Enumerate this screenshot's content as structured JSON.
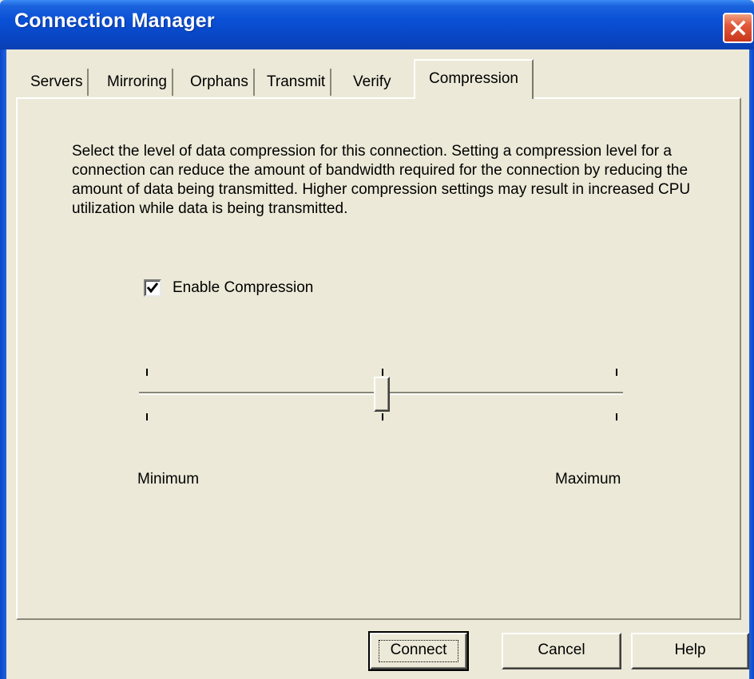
{
  "window": {
    "title": "Connection Manager"
  },
  "tabs": [
    {
      "label": "Servers"
    },
    {
      "label": "Mirroring"
    },
    {
      "label": "Orphans"
    },
    {
      "label": "Transmit"
    },
    {
      "label": "Verify"
    },
    {
      "label": "Compression",
      "active": true
    }
  ],
  "compression": {
    "description": "Select the level of data compression for this connection.  Setting a compression level for a connection can reduce the amount of bandwidth required for the connection by reducing the amount of data being transmitted. Higher compression settings may result in increased CPU utilization while data is being transmitted.",
    "enable_checkbox": {
      "label": "Enable Compression",
      "checked": true
    },
    "slider": {
      "min_label": "Minimum",
      "max_label": "Maximum",
      "level_fraction": 0.5
    }
  },
  "buttons": {
    "connect": "Connect",
    "cancel": "Cancel",
    "help": "Help"
  },
  "colors": {
    "titlebar": "#0a50d6",
    "dialog_face": "#ece9d8",
    "close_button": "#e2593a"
  },
  "icons": {
    "close": "close-icon",
    "checkmark": "checkmark-icon"
  }
}
